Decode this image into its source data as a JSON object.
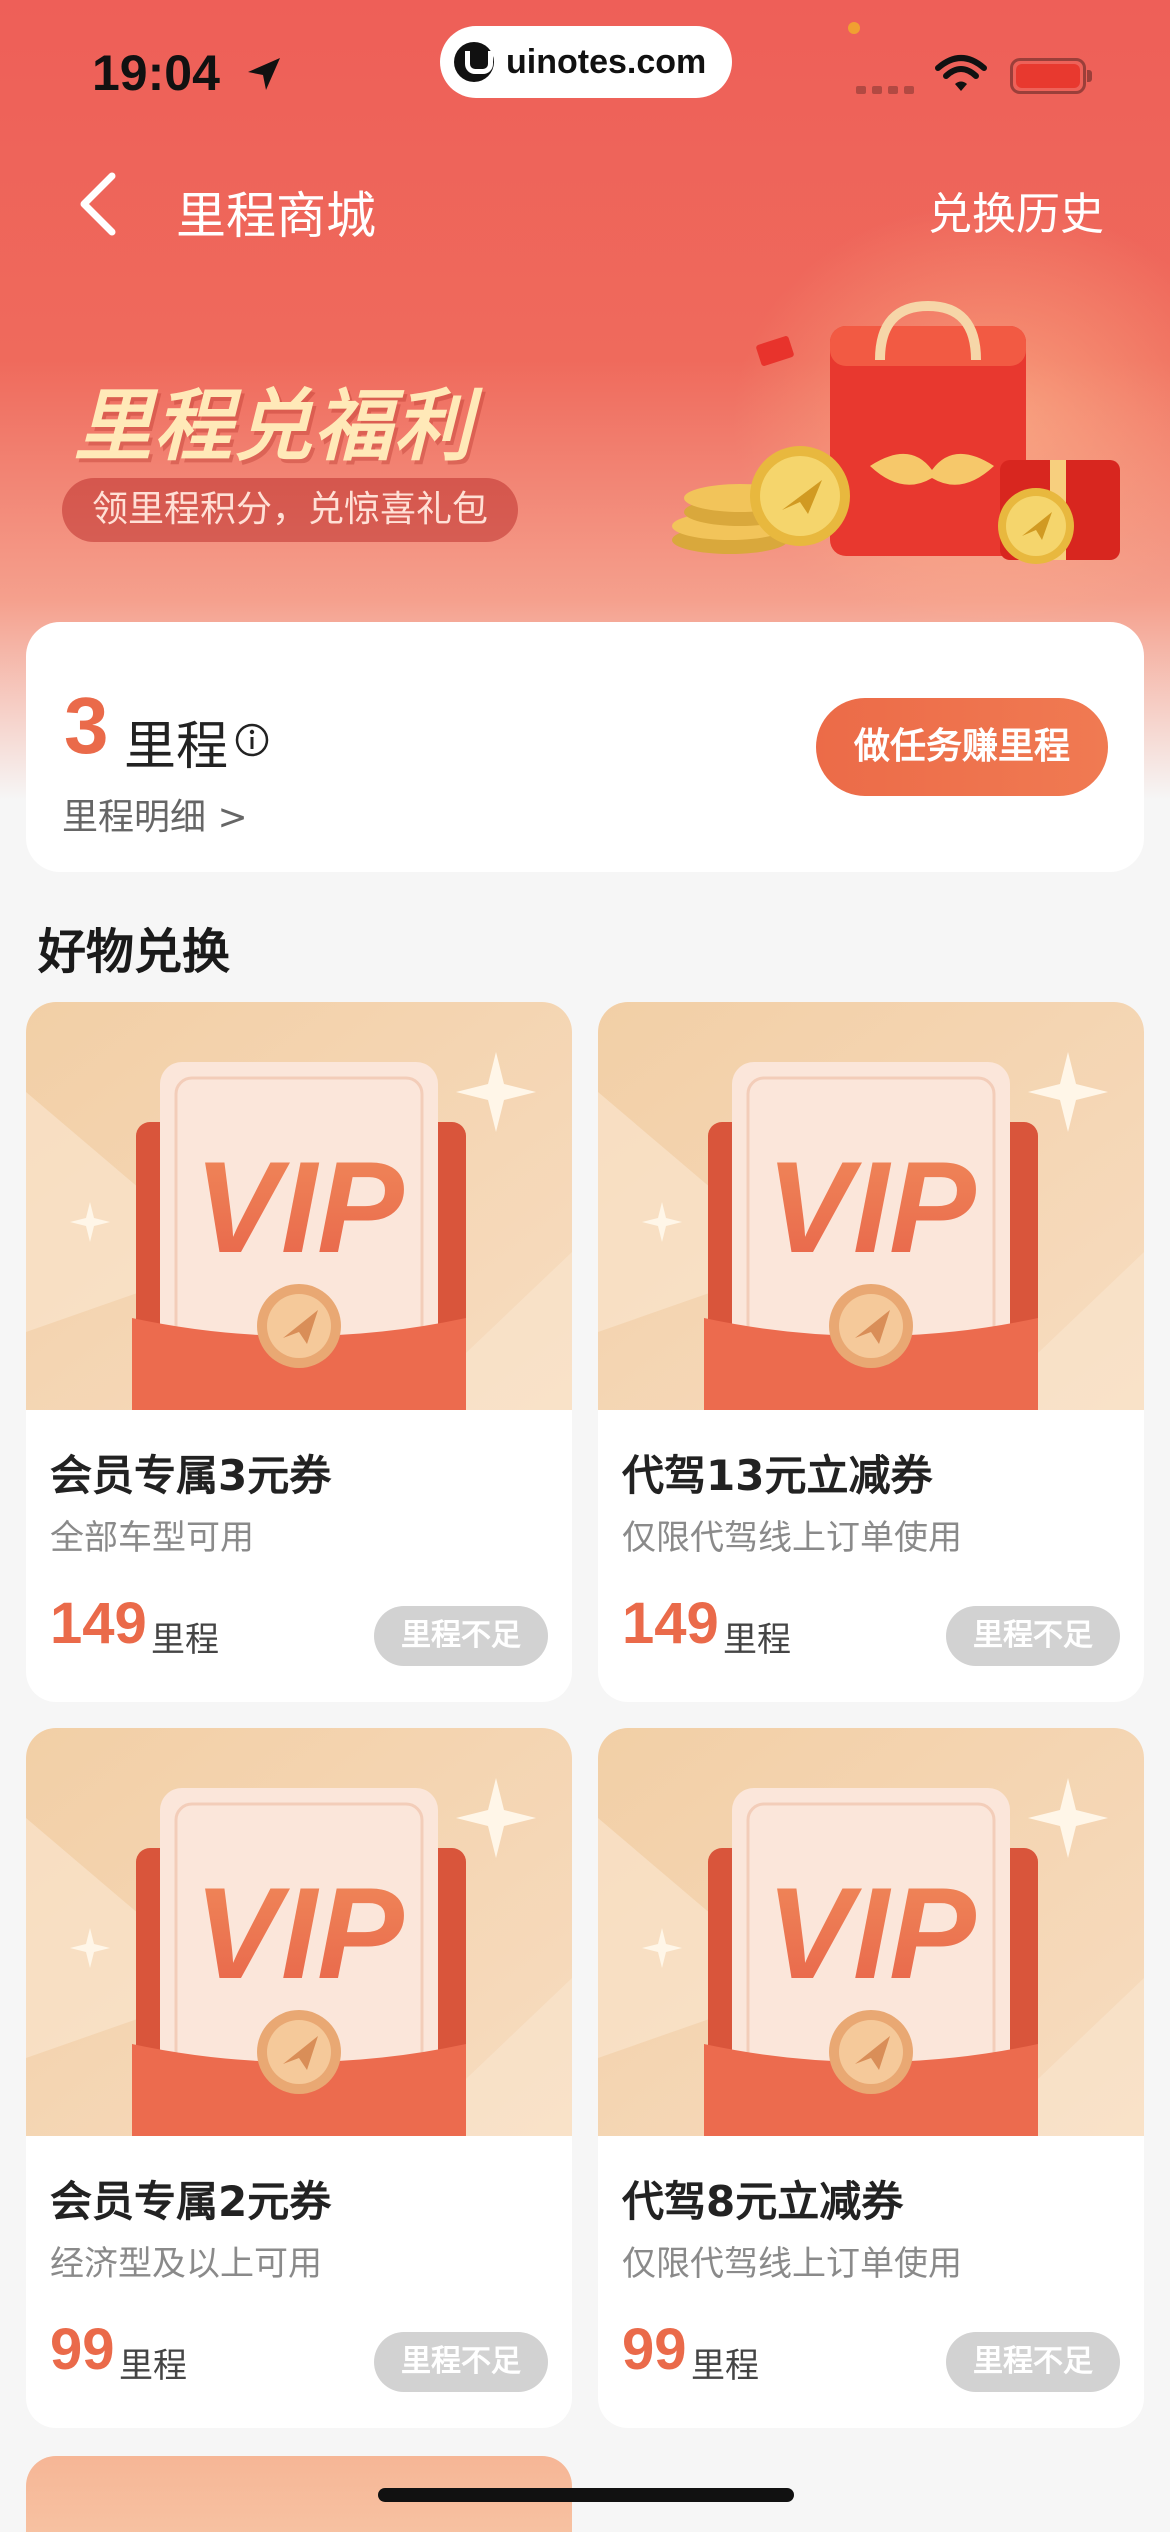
{
  "status_bar": {
    "time": "19:04",
    "url": "uinotes.com"
  },
  "nav": {
    "title": "里程商城",
    "history_label": "兑换历史"
  },
  "banner": {
    "title": "里程兑福利",
    "subtitle": "领里程积分，兑惊喜礼包"
  },
  "mileage": {
    "value": "3",
    "unit": "里程",
    "detail_label": "里程明细 >",
    "task_button": "做任务赚里程"
  },
  "section": {
    "title": "好物兑换"
  },
  "products": [
    {
      "badge": "VIP",
      "name": "会员专属3元券",
      "desc": "全部车型可用",
      "price": "149",
      "unit": "里程",
      "button": "里程不足"
    },
    {
      "badge": "VIP",
      "name": "代驾13元立减券",
      "desc": "仅限代驾线上订单使用",
      "price": "149",
      "unit": "里程",
      "button": "里程不足"
    },
    {
      "badge": "VIP",
      "name": "会员专属2元券",
      "desc": "经济型及以上可用",
      "price": "99",
      "unit": "里程",
      "button": "里程不足"
    },
    {
      "badge": "VIP",
      "name": "代驾8元立减券",
      "desc": "仅限代驾线上订单使用",
      "price": "99",
      "unit": "里程",
      "button": "里程不足"
    }
  ],
  "colors": {
    "brand": "#ee5f58",
    "accent": "#ea6a4a",
    "disabled": "#d2d2d2"
  }
}
